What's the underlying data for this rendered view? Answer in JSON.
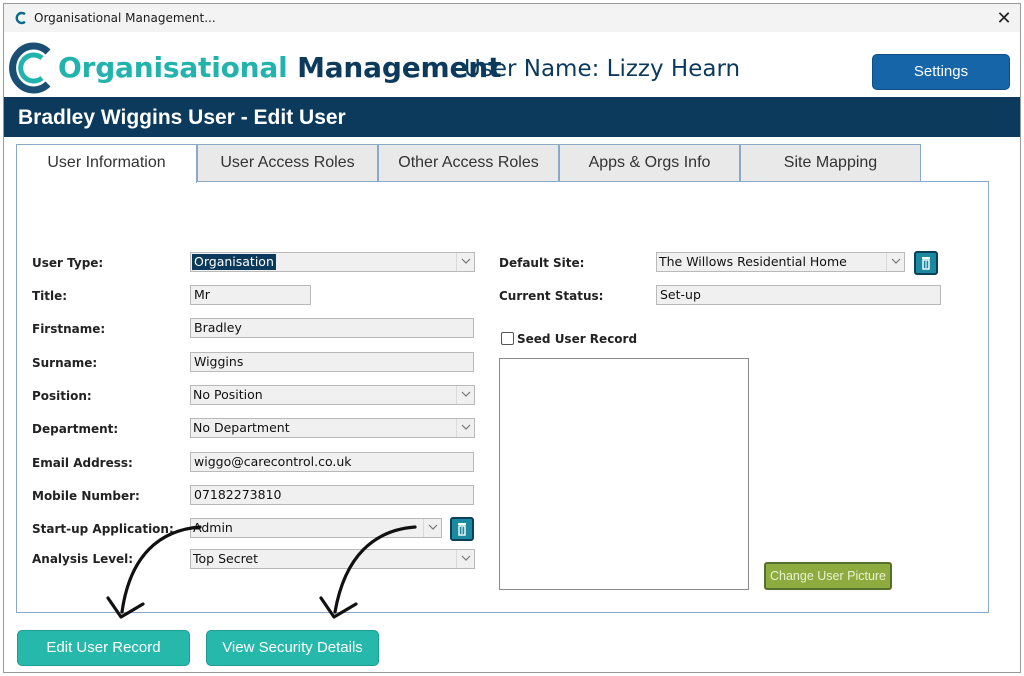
{
  "window": {
    "title": "Organisational Management...",
    "close_glyph": "✕"
  },
  "header": {
    "brand_part1": "Organisational",
    "brand_part2": "Management",
    "username": "User Name: Lizzy Hearn",
    "settings_label": "Settings"
  },
  "page": {
    "title": "Bradley Wiggins User - Edit User"
  },
  "tabs": [
    {
      "label": "User Information",
      "active": true
    },
    {
      "label": "User Access Roles",
      "active": false
    },
    {
      "label": "Other Access Roles",
      "active": false
    },
    {
      "label": "Apps & Orgs Info",
      "active": false
    },
    {
      "label": "Site Mapping",
      "active": false
    }
  ],
  "form_left": {
    "user_type": {
      "label": "User Type:",
      "value": "Organisation"
    },
    "title": {
      "label": "Title:",
      "value": "Mr"
    },
    "firstname": {
      "label": "Firstname:",
      "value": "Bradley"
    },
    "surname": {
      "label": "Surname:",
      "value": "Wiggins"
    },
    "position": {
      "label": "Position:",
      "value": "No Position"
    },
    "department": {
      "label": "Department:",
      "value": "No Department"
    },
    "email": {
      "label": "Email Address:",
      "value": "wiggo@carecontrol.co.uk"
    },
    "mobile": {
      "label": "Mobile Number:",
      "value": "07182273810"
    },
    "startup_app": {
      "label": "Start-up Application:",
      "value": "Admin"
    },
    "analysis_level": {
      "label": "Analysis Level:",
      "value": "Top Secret"
    }
  },
  "form_right": {
    "default_site": {
      "label": "Default Site:",
      "value": "The Willows Residential Home"
    },
    "current_status": {
      "label": "Current Status:",
      "value": "Set-up"
    },
    "seed_label": "Seed User Record",
    "seed_checked": false,
    "change_picture_label": "Change User Picture"
  },
  "buttons": {
    "edit_user_record": "Edit User Record",
    "view_security_details": "View Security Details"
  },
  "colors": {
    "navy": "#0b3a5c",
    "teal": "#23b3ad",
    "button_teal": "#26b8aa",
    "settings_blue": "#1565a8",
    "olive": "#8dab3f"
  },
  "icons": [
    "app-logo-icon",
    "close-icon",
    "trash-icon",
    "chevron-down-icon",
    "annotation-arrow"
  ]
}
